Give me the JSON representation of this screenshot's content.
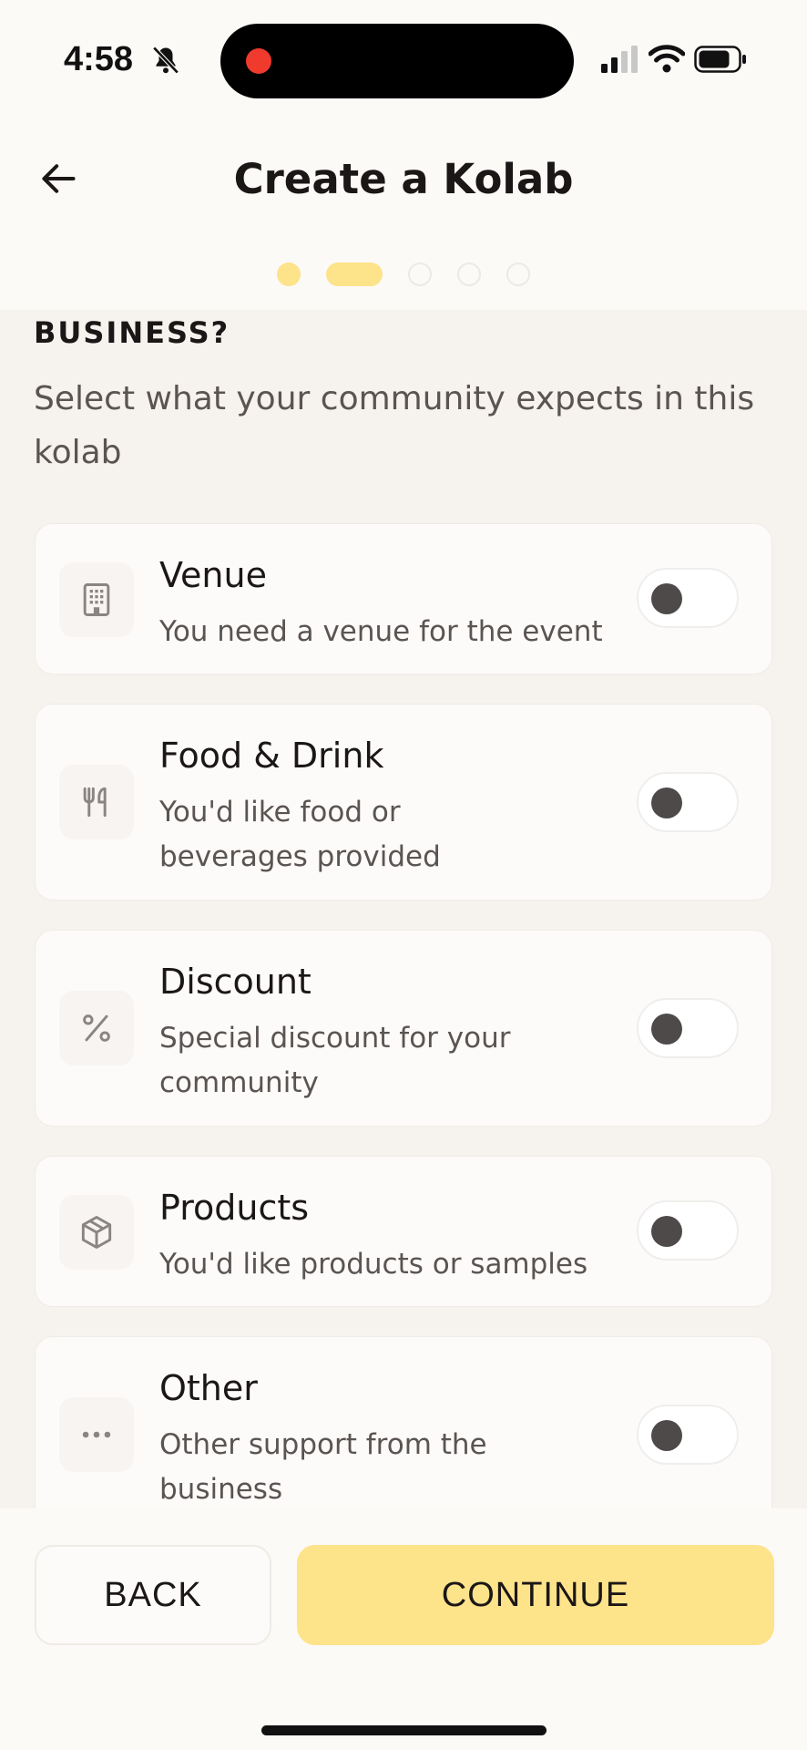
{
  "status_bar": {
    "time": "4:58"
  },
  "header": {
    "title": "Create a Kolab",
    "steps": [
      "done",
      "current",
      "todo",
      "todo",
      "todo"
    ]
  },
  "section": {
    "heading": "BUSINESS?",
    "subtitle": "Select what your community expects in this kolab"
  },
  "options": [
    {
      "icon": "building-icon",
      "title": "Venue",
      "description": "You need a venue for the event",
      "enabled": false
    },
    {
      "icon": "fork-knife-icon",
      "title": "Food & Drink",
      "description": "You'd like food or beverages provided",
      "enabled": false
    },
    {
      "icon": "percent-icon",
      "title": "Discount",
      "description": "Special discount for your community",
      "enabled": false
    },
    {
      "icon": "box-icon",
      "title": "Products",
      "description": "You'd like products or samples",
      "enabled": false
    },
    {
      "icon": "more-icon",
      "title": "Other",
      "description": "Other support from the business",
      "enabled": false
    }
  ],
  "footer": {
    "back_label": "BACK",
    "continue_label": "CONTINUE"
  },
  "colors": {
    "accent": "#fde38a",
    "background": "#fcfaf7",
    "content_background": "#f6f2ee",
    "text": "#1b1717",
    "muted_text": "#5a5452",
    "recording": "#f03a2e"
  }
}
